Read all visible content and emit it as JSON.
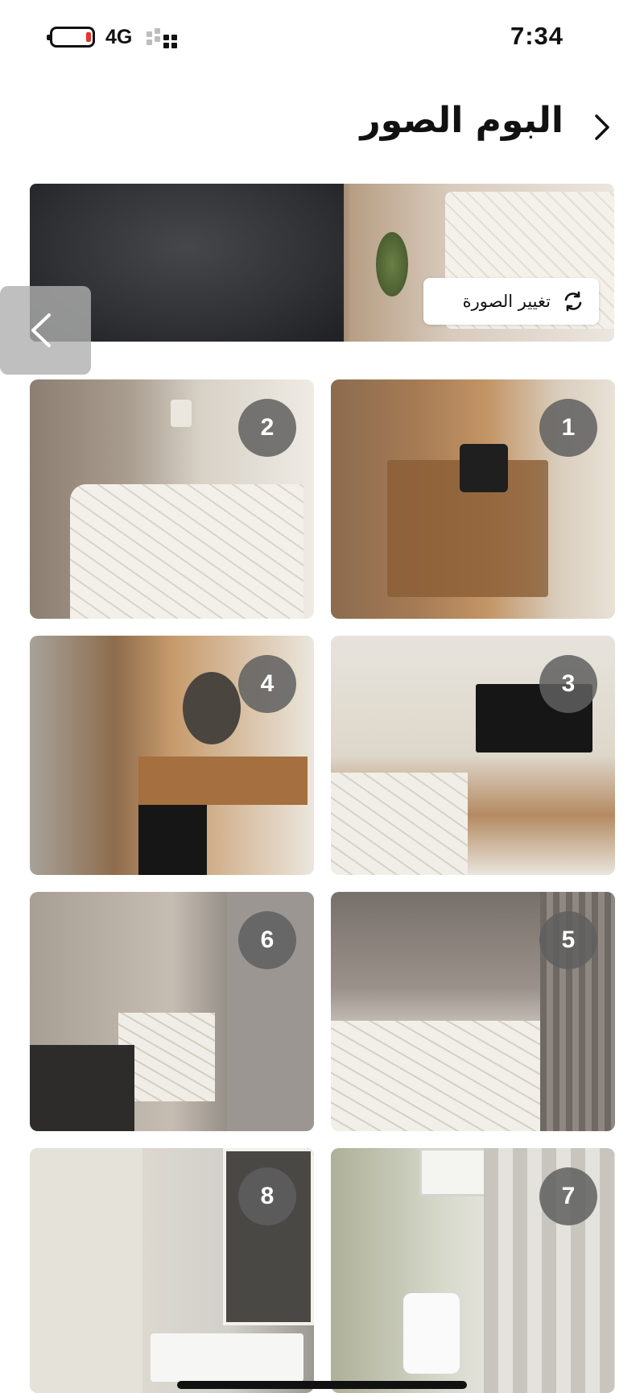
{
  "status_bar": {
    "network": "4G",
    "time": "7:34",
    "battery_icon": "battery-low-icon",
    "signal_icon": "signal-icon"
  },
  "header": {
    "title": "البوم الصور",
    "back_icon": "chevron-right-icon"
  },
  "hero": {
    "change_photo_label": "تغيير الصورة",
    "change_photo_icon": "refresh-icon",
    "prev_icon": "chevron-left-icon"
  },
  "photos": [
    {
      "number": "1"
    },
    {
      "number": "2"
    },
    {
      "number": "3"
    },
    {
      "number": "4"
    },
    {
      "number": "5"
    },
    {
      "number": "6"
    },
    {
      "number": "7"
    },
    {
      "number": "8"
    }
  ],
  "colors": {
    "battery_low": "#e5352b",
    "badge_bg": "#5f5f5f",
    "overlay_button_bg": "#afafaf"
  }
}
